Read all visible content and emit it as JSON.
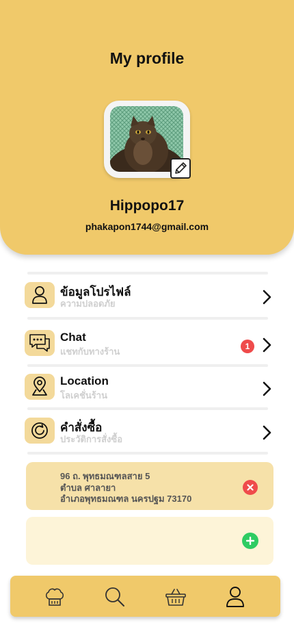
{
  "header": {
    "title": "My profile",
    "username": "Hippopo17",
    "email": "phakapon1744@gmail.com"
  },
  "menu": {
    "items": [
      {
        "title": "ข้อมูลโปรไฟล์",
        "subtitle": "ความปลอดภัย",
        "icon": "user-icon"
      },
      {
        "title": "Chat",
        "subtitle": "แชทกับทางร้าน",
        "icon": "chat-bubble-icon",
        "badge": "1"
      },
      {
        "title": "Location",
        "subtitle": "โลเคชั่นร้าน",
        "icon": "map-pin-icon"
      },
      {
        "title": "คำสั่งซื้อ",
        "subtitle": "ประวัติการสั่งซื้อ",
        "icon": "history-icon"
      }
    ]
  },
  "address": {
    "line1": "96 ถ. พุทธมณฑลสาย 5",
    "line2": "ตำบล  ศาลายา",
    "line3": "อำเภอพุทธมณฑล นครปฐม 73170"
  },
  "bottom_nav": [
    "chef-hat-icon",
    "search-icon",
    "basket-icon",
    "user-icon"
  ],
  "colors": {
    "primary": "#f0c96a",
    "icon_bg": "#f3d99a",
    "address_bg": "#f6e1a9",
    "add_bg": "#fdf4d8",
    "danger": "#ef4b4b",
    "success": "#2ecc63"
  }
}
